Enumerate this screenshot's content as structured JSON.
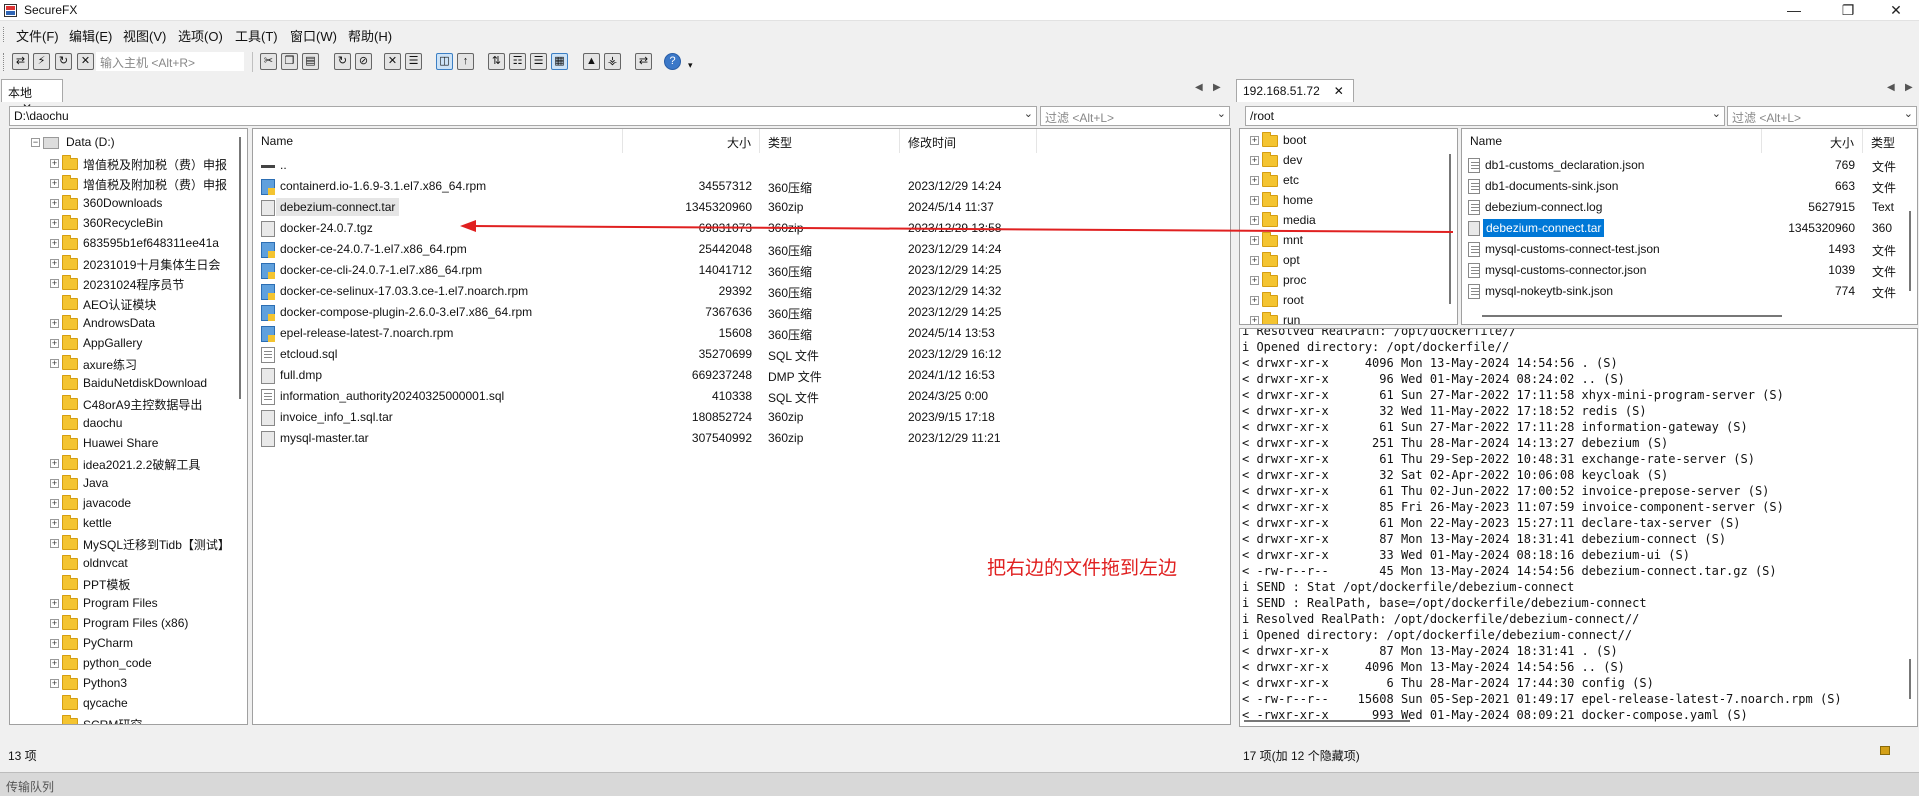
{
  "window": {
    "title": "SecureFX"
  },
  "menu": [
    "文件(F)",
    "编辑(E)",
    "视图(V)",
    "选项(O)",
    "工具(T)",
    "窗口(W)",
    "帮助(H)"
  ],
  "toolbar": {
    "host_placeholder": "输入主机 <Alt+R>"
  },
  "left": {
    "tab": "本地",
    "path": "D:\\daochu",
    "filter": "过滤 <Alt+L>",
    "tree_root": "Data (D:)",
    "tree": [
      "增值税及附加税（费）申报",
      "增值税及附加税（费）申报",
      "360Downloads",
      "360RecycleBin",
      "683595b1ef648311ee41a",
      "20231019十月集体生日会",
      "20231024程序员节",
      "AEO认证模块",
      "AndrowsData",
      "AppGallery",
      "axure练习",
      "BaiduNetdiskDownload",
      "C48orA9主控数据导出",
      "daochu",
      "Huawei Share",
      "idea2021.2.2破解工具",
      "Java",
      "javacode",
      "kettle",
      "MySQL迁移到Tidb【测试】",
      "oldnvcat",
      "PPT模板",
      "Program Files",
      "Program Files (x86)",
      "PyCharm",
      "python_code",
      "Python3",
      "qycache",
      "SCRM研究"
    ],
    "columns": {
      "name": "Name",
      "size": "大小",
      "type": "类型",
      "modified": "修改时间"
    },
    "files": [
      {
        "name": "..",
        "size": "",
        "type": "",
        "modified": ""
      },
      {
        "name": "containerd.io-1.6.9-3.1.el7.x86_64.rpm",
        "size": "34557312",
        "type": "360压缩",
        "modified": "2023/12/29 14:24"
      },
      {
        "name": "debezium-connect.tar",
        "size": "1345320960",
        "type": "360zip",
        "modified": "2024/5/14 11:37"
      },
      {
        "name": "docker-24.0.7.tgz",
        "size": "69831073",
        "type": "360zip",
        "modified": "2023/12/29 13:58"
      },
      {
        "name": "docker-ce-24.0.7-1.el7.x86_64.rpm",
        "size": "25442048",
        "type": "360压缩",
        "modified": "2023/12/29 14:24"
      },
      {
        "name": "docker-ce-cli-24.0.7-1.el7.x86_64.rpm",
        "size": "14041712",
        "type": "360压缩",
        "modified": "2023/12/29 14:25"
      },
      {
        "name": "docker-ce-selinux-17.03.3.ce-1.el7.noarch.rpm",
        "size": "29392",
        "type": "360压缩",
        "modified": "2023/12/29 14:32"
      },
      {
        "name": "docker-compose-plugin-2.6.0-3.el7.x86_64.rpm",
        "size": "7367636",
        "type": "360压缩",
        "modified": "2023/12/29 14:25"
      },
      {
        "name": "epel-release-latest-7.noarch.rpm",
        "size": "15608",
        "type": "360压缩",
        "modified": "2024/5/14 13:53"
      },
      {
        "name": "etcloud.sql",
        "size": "35270699",
        "type": "SQL 文件",
        "modified": "2023/12/29 16:12"
      },
      {
        "name": "full.dmp",
        "size": "669237248",
        "type": "DMP 文件",
        "modified": "2024/1/12 16:53"
      },
      {
        "name": "information_authority20240325000001.sql",
        "size": "410338",
        "type": "SQL 文件",
        "modified": "2024/3/25 0:00"
      },
      {
        "name": "invoice_info_1.sql.tar",
        "size": "180852724",
        "type": "360zip",
        "modified": "2023/9/15 17:18"
      },
      {
        "name": "mysql-master.tar",
        "size": "307540992",
        "type": "360zip",
        "modified": "2023/12/29 11:21"
      }
    ],
    "status": "13 项"
  },
  "annotation": "把右边的文件拖到左边",
  "right": {
    "tab": "192.168.51.72",
    "path": "/root",
    "filter": "过滤 <Alt+L>",
    "tree": [
      "boot",
      "dev",
      "etc",
      "home",
      "media",
      "mnt",
      "opt",
      "proc",
      "root",
      "run"
    ],
    "columns": {
      "name": "Name",
      "size": "大小",
      "type": "类型"
    },
    "files": [
      {
        "name": "db1-customs_declaration.json",
        "size": "769",
        "type": "文件"
      },
      {
        "name": "db1-documents-sink.json",
        "size": "663",
        "type": "文件"
      },
      {
        "name": "debezium-connect.log",
        "size": "5627915",
        "type": "Text"
      },
      {
        "name": "debezium-connect.tar",
        "size": "1345320960",
        "type": "360"
      },
      {
        "name": "mysql-customs-connect-test.json",
        "size": "1493",
        "type": "文件"
      },
      {
        "name": "mysql-customs-connector.json",
        "size": "1039",
        "type": "文件"
      },
      {
        "name": "mysql-nokeytb-sink.json",
        "size": "774",
        "type": "文件"
      }
    ],
    "log": [
      "i Resolved RealPath: /opt/dockerfile//",
      "i Opened directory: /opt/dockerfile//",
      "< drwxr-xr-x     4096 Mon 13-May-2024 14:54:56 . (S)",
      "< drwxr-xr-x       96 Wed 01-May-2024 08:24:02 .. (S)",
      "< drwxr-xr-x       61 Sun 27-Mar-2022 17:11:58 xhyx-mini-program-server (S)",
      "< drwxr-xr-x       32 Wed 11-May-2022 17:18:52 redis (S)",
      "< drwxr-xr-x       61 Sun 27-Mar-2022 17:11:28 information-gateway (S)",
      "< drwxr-xr-x      251 Thu 28-Mar-2024 14:13:27 debezium (S)",
      "< drwxr-xr-x       61 Thu 29-Sep-2022 10:48:31 exchange-rate-server (S)",
      "< drwxr-xr-x       32 Sat 02-Apr-2022 10:06:08 keycloak (S)",
      "< drwxr-xr-x       61 Thu 02-Jun-2022 17:00:52 invoice-prepose-server (S)",
      "< drwxr-xr-x       85 Fri 26-May-2023 11:07:59 invoice-component-server (S)",
      "< drwxr-xr-x       61 Mon 22-May-2023 15:27:11 declare-tax-server (S)",
      "< drwxr-xr-x       87 Mon 13-May-2024 18:31:41 debezium-connect (S)",
      "< drwxr-xr-x       33 Wed 01-May-2024 08:18:16 debezium-ui (S)",
      "< -rw-r--r--       45 Mon 13-May-2024 14:54:56 debezium-connect.tar.gz (S)",
      "i SEND : Stat /opt/dockerfile/debezium-connect",
      "i SEND : RealPath, base=/opt/dockerfile/debezium-connect",
      "i Resolved RealPath: /opt/dockerfile/debezium-connect//",
      "i Opened directory: /opt/dockerfile/debezium-connect//",
      "< drwxr-xr-x       87 Mon 13-May-2024 18:31:41 . (S)",
      "< drwxr-xr-x     4096 Mon 13-May-2024 14:54:56 .. (S)",
      "< drwxr-xr-x        6 Thu 28-Mar-2024 17:44:30 config (S)",
      "< -rw-r--r--    15608 Sun 05-Sep-2021 01:49:17 epel-release-latest-7.noarch.rpm (S)",
      "< -rwxr-xr-x      993 Wed 01-May-2024 08:09:21 docker-compose.yaml (S)"
    ],
    "status": "17 项(加 12 个隐藏项)"
  },
  "queue": {
    "label": "传输队列"
  },
  "colors": {
    "selection": "#0078d7",
    "arrow": "#e02020",
    "annotation": "#e02020"
  }
}
